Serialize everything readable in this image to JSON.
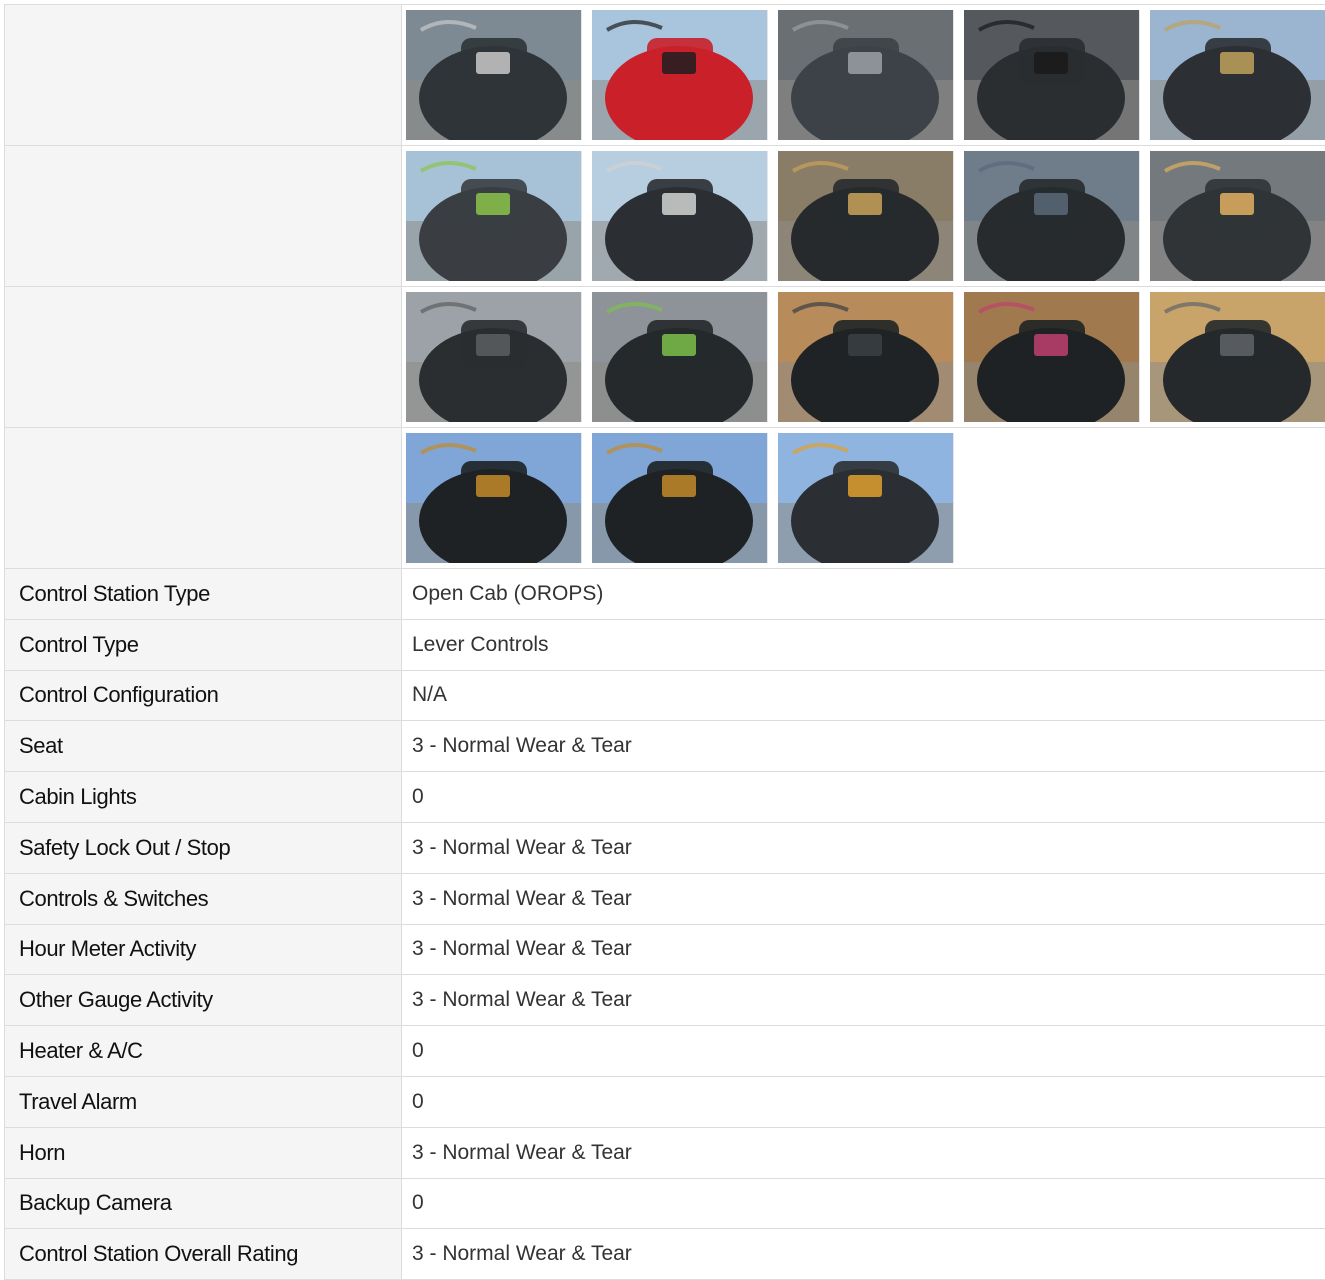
{
  "photo_rows": [
    {
      "photos": [
        {
          "icon": "seat-back-decal-photo-icon",
          "sky": "#7e8a93",
          "main": "#2f3438",
          "accent": "#c9c9c9"
        },
        {
          "icon": "red-panel-photo-icon",
          "sky": "#a9c4dd",
          "main": "#c9202a",
          "accent": "#1e1e1e"
        },
        {
          "icon": "floor-pedal-photo-icon",
          "sky": "#6a6f73",
          "main": "#3c4247",
          "accent": "#9aa0a4"
        },
        {
          "icon": "switch-panel-photo-icon",
          "sky": "#55595d",
          "main": "#2a2e31",
          "accent": "#1a1a1a"
        },
        {
          "icon": "ignition-key-photo-icon",
          "sky": "#9bb4cf",
          "main": "#2c3034",
          "accent": "#bfa15a"
        }
      ]
    },
    {
      "photos": [
        {
          "icon": "lift-levers-photo-icon",
          "sky": "#a7c2d6",
          "main": "#3a3e42",
          "accent": "#8bc34a"
        },
        {
          "icon": "lever-knobs-photo-icon",
          "sky": "#b7cde0",
          "main": "#2b2f33",
          "accent": "#d2d2d2"
        },
        {
          "icon": "shift-lever-photo-icon",
          "sky": "#8a7d67",
          "main": "#262a2d",
          "accent": "#c9a35a"
        },
        {
          "icon": "joystick-boot-photo-icon",
          "sky": "#6f7d8b",
          "main": "#272b2e",
          "accent": "#5a6a7a"
        },
        {
          "icon": "side-handle-photo-icon",
          "sky": "#74797d",
          "main": "#303437",
          "accent": "#e0b060"
        }
      ]
    },
    {
      "photos": [
        {
          "icon": "steering-column-photo-icon",
          "sky": "#9ca2a7",
          "main": "#2a2e31",
          "accent": "#5c5f61"
        },
        {
          "icon": "engine-compartment-photo-icon",
          "sky": "#8d9399",
          "main": "#25292b",
          "accent": "#7cc04a"
        },
        {
          "icon": "seat-backrest-photo-icon",
          "sky": "#b88b5a",
          "main": "#1f2326",
          "accent": "#3a3f43"
        },
        {
          "icon": "seat-cushion-photo-icon",
          "sky": "#a07a4e",
          "main": "#1e2225",
          "accent": "#c04070"
        },
        {
          "icon": "seat-belt-photo-icon",
          "sky": "#c8a36a",
          "main": "#25292c",
          "accent": "#606468"
        }
      ]
    },
    {
      "photos": [
        {
          "icon": "operator-seat-photo-icon",
          "sky": "#7fa6d6",
          "main": "#1e2225",
          "accent": "#c48a2a"
        },
        {
          "icon": "operator-seat-photo-icon",
          "sky": "#7fa6d6",
          "main": "#1e2225",
          "accent": "#c48a2a"
        },
        {
          "icon": "forklift-overview-photo-icon",
          "sky": "#8fb4e0",
          "main": "#2b2f33",
          "accent": "#e0a030"
        }
      ]
    }
  ],
  "attributes": [
    {
      "label": "Control Station Type",
      "value": "Open Cab (OROPS)"
    },
    {
      "label": "Control Type",
      "value": "Lever Controls"
    },
    {
      "label": "Control Configuration",
      "value": "N/A"
    },
    {
      "label": "Seat",
      "value": "3 - Normal Wear & Tear"
    },
    {
      "label": "Cabin Lights",
      "value": "0"
    },
    {
      "label": "Safety Lock Out / Stop",
      "value": "3 - Normal Wear & Tear"
    },
    {
      "label": "Controls & Switches",
      "value": "3 - Normal Wear & Tear"
    },
    {
      "label": "Hour Meter Activity",
      "value": "3 - Normal Wear & Tear"
    },
    {
      "label": "Other Gauge Activity",
      "value": "3 - Normal Wear & Tear"
    },
    {
      "label": "Heater & A/C",
      "value": "0"
    },
    {
      "label": "Travel Alarm",
      "value": "0"
    },
    {
      "label": "Horn",
      "value": "3 - Normal Wear & Tear"
    },
    {
      "label": "Backup Camera",
      "value": "0"
    },
    {
      "label": "Control Station Overall Rating",
      "value": "3 - Normal Wear & Tear"
    }
  ]
}
